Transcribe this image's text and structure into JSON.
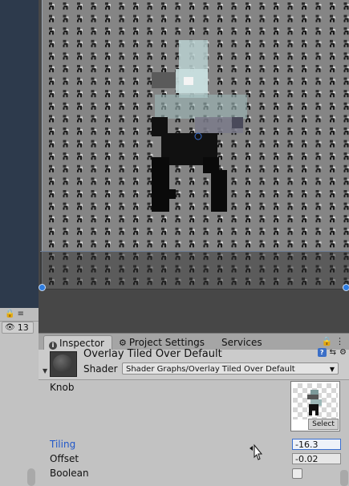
{
  "hierarchy": {
    "hidden_count": "13",
    "lock_icon": "lock-icon",
    "menu_icon": "menu-icon"
  },
  "tabs": {
    "inspector": "Inspector",
    "project_settings": "Project Settings",
    "services": "Services"
  },
  "material": {
    "name": "Overlay Tiled Over Default",
    "shader_label": "Shader",
    "shader_value": "Shader Graphs/Overlay Tiled Over Default"
  },
  "properties": {
    "knob_label": "Knob",
    "select_label": "Select",
    "tiling_label": "Tiling",
    "tiling_value": "-16.3",
    "offset_label": "Offset",
    "offset_value": "-0.02",
    "boolean_label": "Boolean",
    "boolean_checked": false
  },
  "colors": {
    "selection_handle": "#2f7de0",
    "tiling_highlight": "#2057c9",
    "scene_tile_bg": "#858585"
  }
}
